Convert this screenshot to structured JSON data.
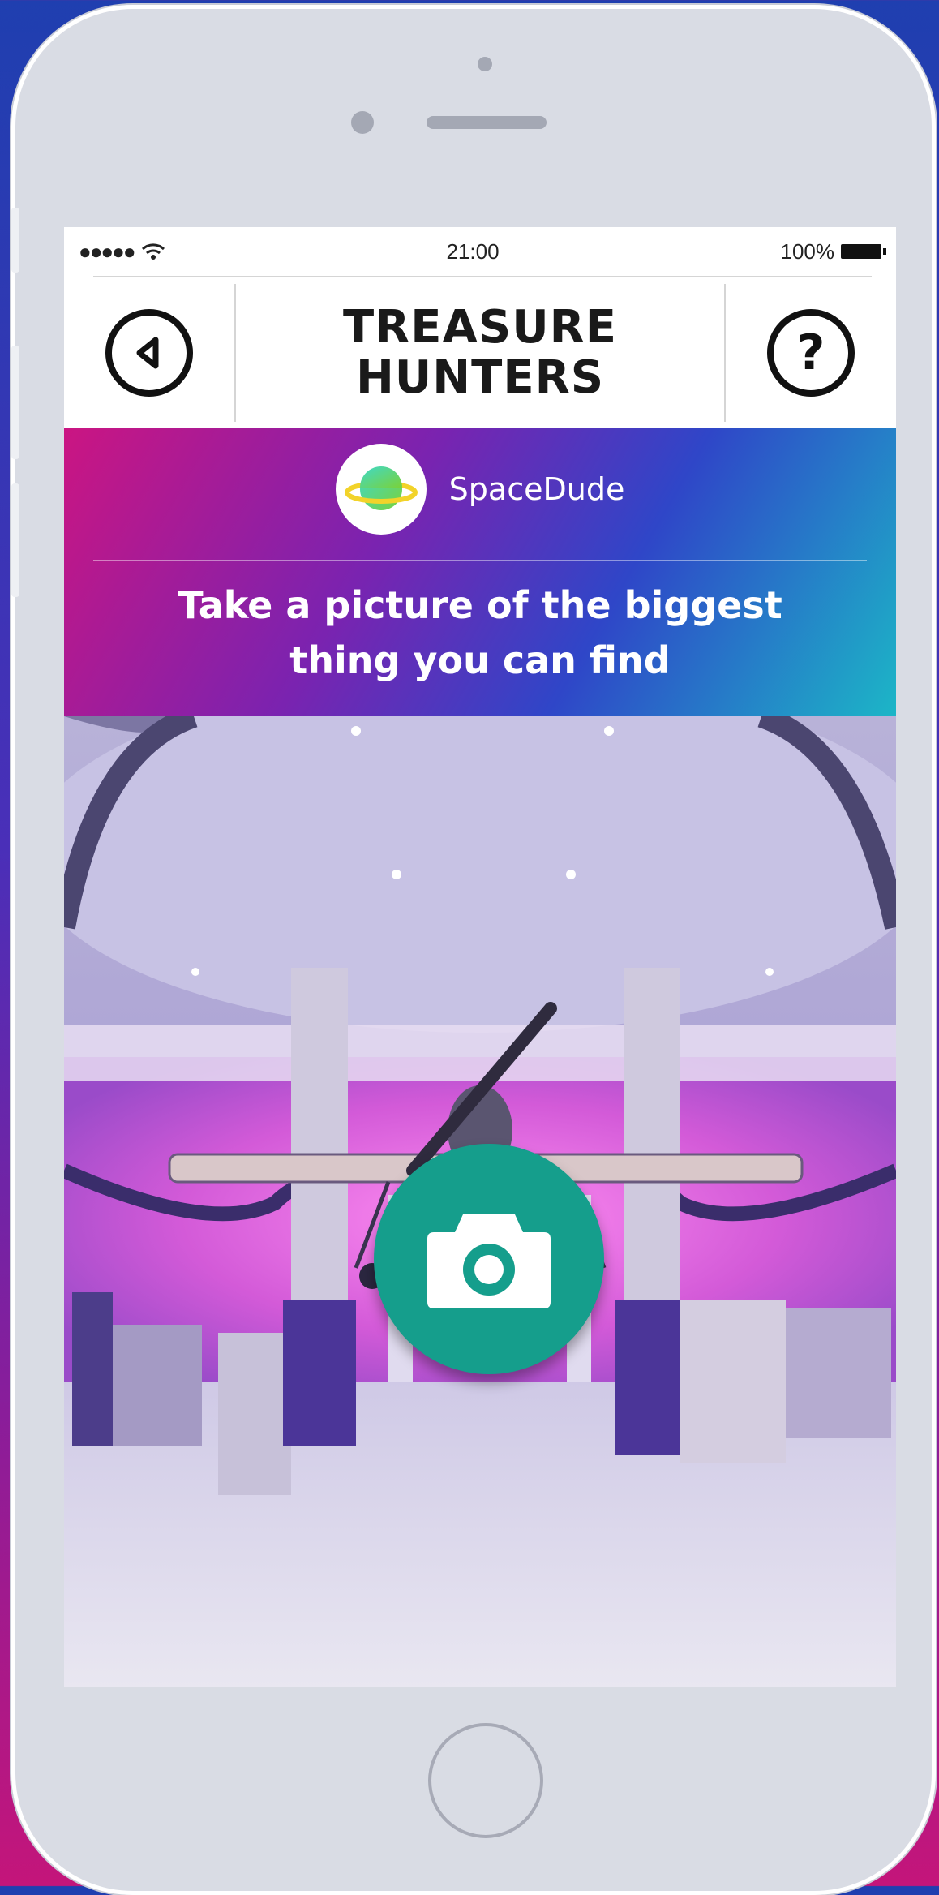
{
  "status_bar": {
    "signal": "●●●●●",
    "time": "21:00",
    "battery": "100%"
  },
  "header": {
    "title_line1": "TREASURE",
    "title_line2": "HUNTERS"
  },
  "nav": {
    "back_icon": "back-arrow-icon",
    "help_icon": "help-icon",
    "help_glyph": "?"
  },
  "player": {
    "username": "SpaceDude",
    "avatar_icon": "planet-icon"
  },
  "challenge": {
    "line1": "Take a picture of the biggest",
    "line2": "thing you can find"
  },
  "camera": {
    "shutter_icon": "camera-icon"
  },
  "colors": {
    "accent_teal": "#159e8c",
    "gradient_pink": "#cb1582",
    "gradient_blue": "#2f46c8",
    "gradient_cyan": "#1cb6c7"
  }
}
